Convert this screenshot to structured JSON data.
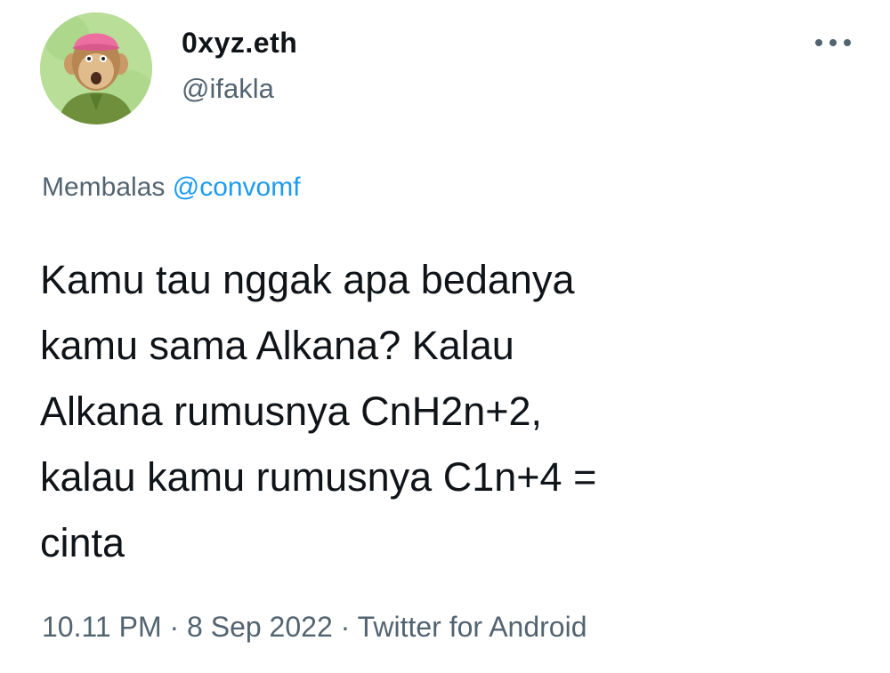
{
  "author": {
    "display_name": "0xyz.eth",
    "handle": "@ifakla",
    "avatar_icon": "monkey-avatar-icon"
  },
  "menu": {
    "icon": "more-options-icon"
  },
  "reply": {
    "prefix": "Membalas",
    "to_handle": "@convomf"
  },
  "tweet": {
    "lines": [
      "Kamu tau nggak apa bedanya",
      "kamu sama Alkana? Kalau",
      "Alkana rumusnya CnH2n+2,",
      "kalau kamu rumusnya C1n+4 =",
      "cinta"
    ]
  },
  "meta": {
    "time": "10.11 PM",
    "separator": "·",
    "date": "8 Sep 2022",
    "source": "Twitter for Android"
  },
  "colors": {
    "text_primary": "#0f1419",
    "text_secondary": "#536471",
    "link": "#1d9bf0"
  }
}
